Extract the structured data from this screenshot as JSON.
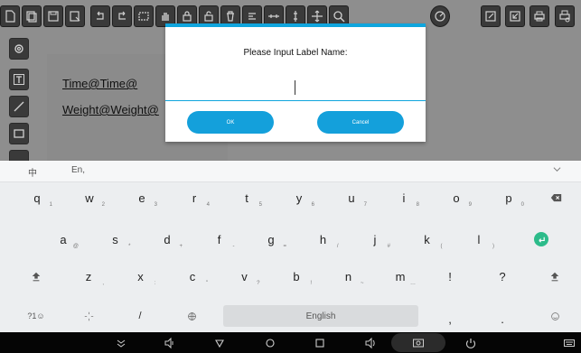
{
  "toolbar": {
    "left_icons": [
      "new-document-icon",
      "copy-icon",
      "save-icon",
      "save-as-icon",
      "undo-icon",
      "redo-icon",
      "select-area-icon",
      "hand-icon",
      "lock-icon",
      "unlock-icon",
      "delete-icon",
      "align-icon",
      "distribute-icon",
      "vertical-distribute-icon",
      "move-icon",
      "zoom-icon",
      "rotate-icon"
    ],
    "right_icons": [
      "edit-icon",
      "export-icon",
      "print-icon",
      "print-settings-icon"
    ]
  },
  "sidebar": {
    "icons": [
      "settings-icon",
      "text-tool-icon",
      "line-tool-icon",
      "rectangle-tool-icon"
    ]
  },
  "canvas": {
    "labels": [
      "Time@Time@",
      "Weight@Weight@"
    ]
  },
  "dialog": {
    "title": "Please Input Label Name:",
    "input_value": "",
    "ok_label": "OK",
    "cancel_label": "Cancel",
    "accent": "#0fa5dd"
  },
  "keyboard": {
    "lang_cn": "中",
    "lang_en": "En,",
    "collapse_icon": "chevron-down-icon",
    "row1": [
      {
        "k": "q",
        "s": "1"
      },
      {
        "k": "w",
        "s": "2"
      },
      {
        "k": "e",
        "s": "3"
      },
      {
        "k": "r",
        "s": "4"
      },
      {
        "k": "t",
        "s": "5"
      },
      {
        "k": "y",
        "s": "6"
      },
      {
        "k": "u",
        "s": "7"
      },
      {
        "k": "i",
        "s": "8"
      },
      {
        "k": "o",
        "s": "9"
      },
      {
        "k": "p",
        "s": "0"
      }
    ],
    "row2": [
      {
        "k": "a",
        "s": "@"
      },
      {
        "k": "s",
        "s": "*"
      },
      {
        "k": "d",
        "s": "+"
      },
      {
        "k": "f",
        "s": "-"
      },
      {
        "k": "g",
        "s": "="
      },
      {
        "k": "h",
        "s": "/"
      },
      {
        "k": "j",
        "s": "#"
      },
      {
        "k": "k",
        "s": "("
      },
      {
        "k": "l",
        "s": ")"
      }
    ],
    "row3": [
      {
        "k": "z",
        "s": ","
      },
      {
        "k": "x",
        "s": ":"
      },
      {
        "k": "c",
        "s": "\""
      },
      {
        "k": "v",
        "s": "?"
      },
      {
        "k": "b",
        "s": "!"
      },
      {
        "k": "n",
        "s": "~"
      },
      {
        "k": "m",
        "s": "…"
      }
    ],
    "row3_extra": [
      "!",
      "?"
    ],
    "symbols_label": "?1☺",
    "slash_label": "/",
    "space_label": "English",
    "comma_label": ",",
    "period_label": ".",
    "enter_color": "#2cbb8a"
  },
  "navbar": {
    "icons": [
      "hide-keyboard-icon",
      "volume-down-icon",
      "back-icon",
      "home-icon",
      "recents-icon",
      "volume-up-icon",
      "screenshot-icon",
      "power-icon",
      "keyboard-icon"
    ]
  }
}
